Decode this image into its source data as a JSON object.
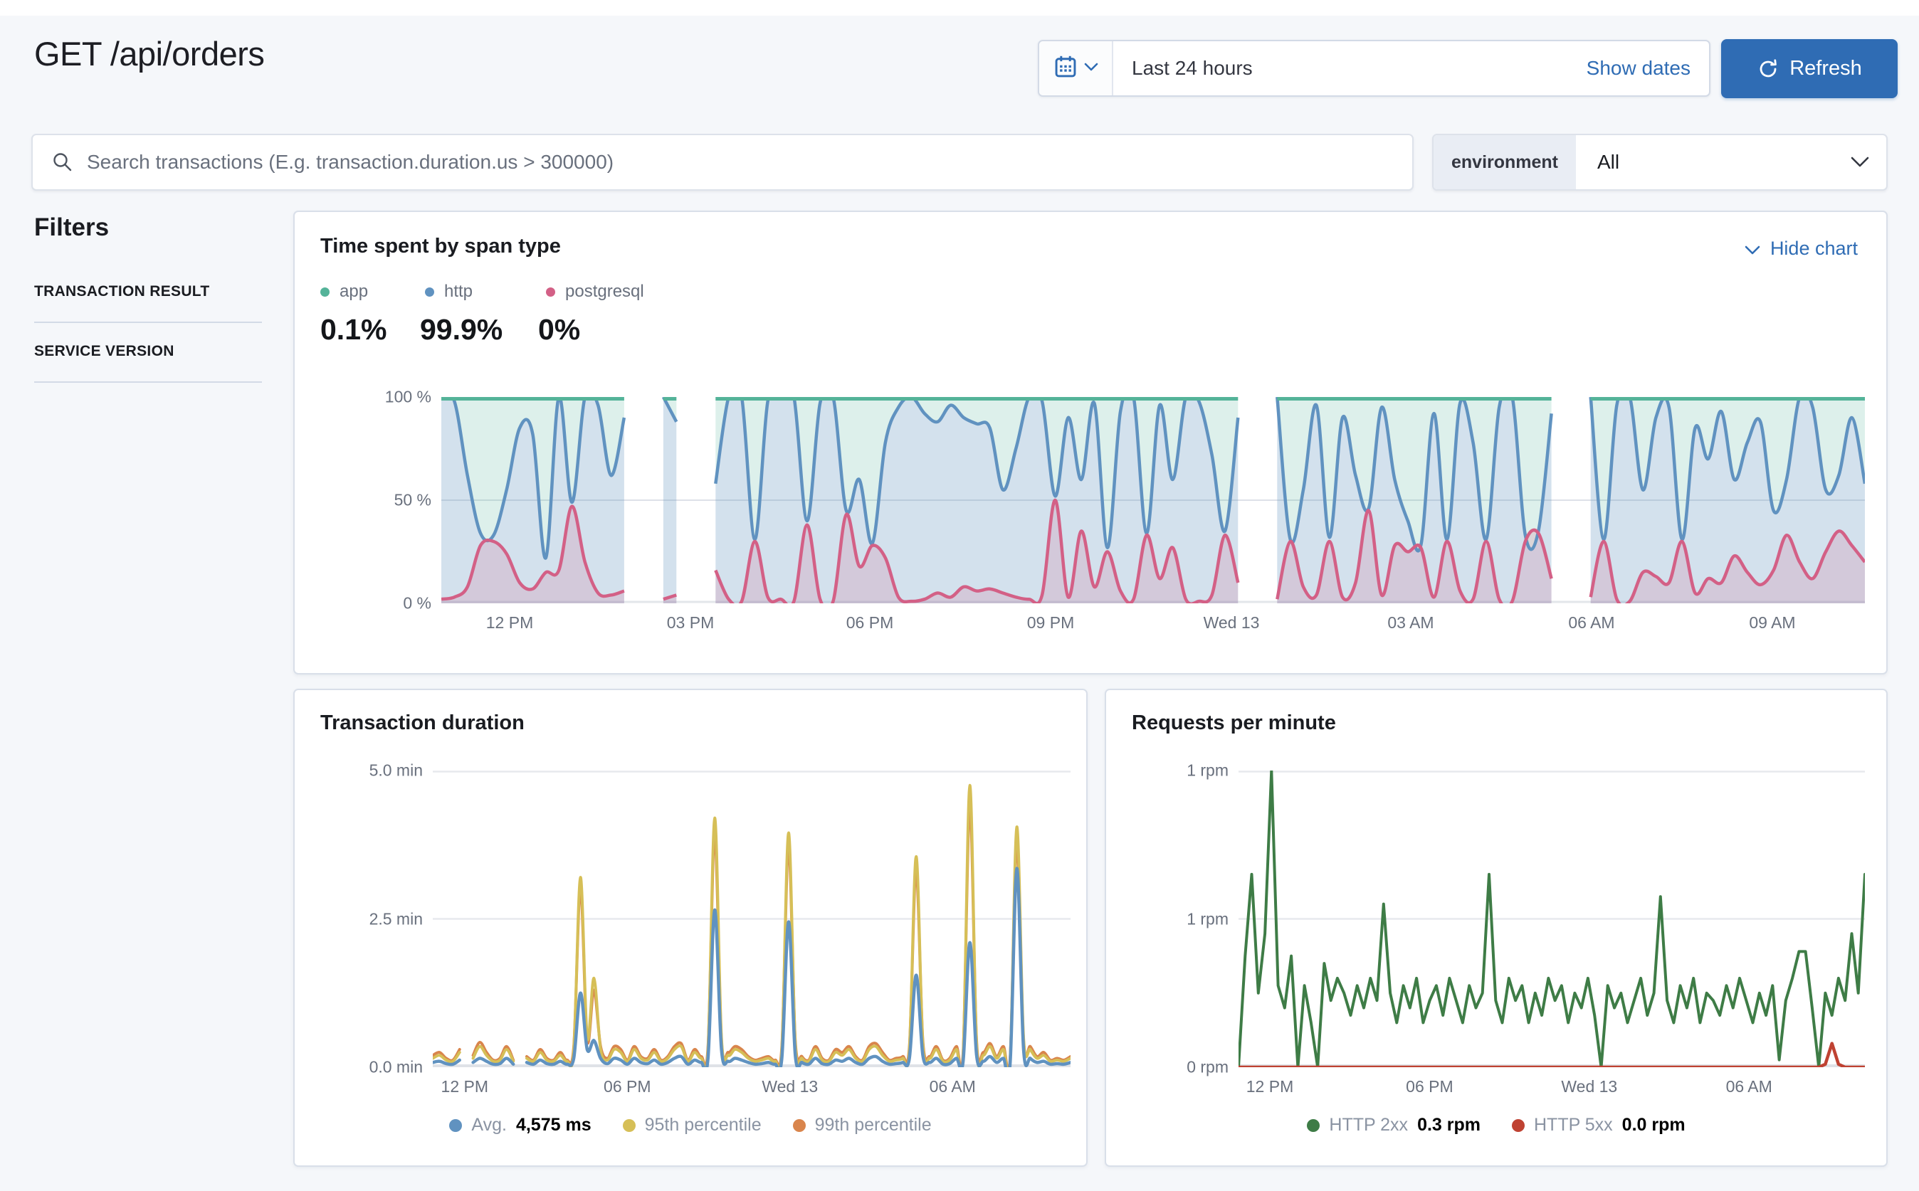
{
  "header": {
    "title": "GET /api/orders",
    "date_picker": {
      "selected_range": "Last 24 hours",
      "show_dates_label": "Show dates"
    },
    "refresh_label": "Refresh"
  },
  "search": {
    "placeholder": "Search transactions (E.g. transaction.duration.us > 300000)",
    "environment_label": "environment",
    "environment_value": "All"
  },
  "filters": {
    "heading": "Filters",
    "sections": [
      {
        "label": "TRANSACTION RESULT"
      },
      {
        "label": "SERVICE VERSION"
      }
    ]
  },
  "colors": {
    "accent_blue": "#2f6cb4",
    "app_green": "#54b399",
    "http_blue": "#6092c0",
    "postgresql_pink": "#d36086",
    "p95_yellow": "#d6bf57",
    "p99_orange": "#d9854c",
    "http2xx_green": "#3e7c46",
    "http5xx_red": "#bf4232"
  },
  "chart_data": [
    {
      "type": "area",
      "title": "Time spent by span type",
      "hide_chart_label": "Hide chart",
      "legend": [
        {
          "label": "app",
          "color": "#54b399",
          "percentage": "0.1%"
        },
        {
          "label": "http",
          "color": "#6092c0",
          "percentage": "99.9%"
        },
        {
          "label": "postgresql",
          "color": "#d36086",
          "percentage": "0%"
        }
      ],
      "ylabel": "",
      "xlabel": "",
      "ylim": [
        0,
        100
      ],
      "y_ticks": [
        "100 %",
        "50 %",
        "0 %"
      ],
      "x_ticks": [
        "12 PM",
        "03 PM",
        "06 PM",
        "09 PM",
        "Wed 13",
        "03 AM",
        "06 AM",
        "09 AM"
      ],
      "x_tick_fracs": [
        0.048,
        0.175,
        0.301,
        0.428,
        0.555,
        0.681,
        0.808,
        0.935
      ],
      "app_fill": "rgba(84,179,153,0.20)",
      "series": [
        {
          "name": "postgresql",
          "color": "#d36086",
          "fill": "rgba(211,96,134,0.18)",
          "values": [
            2,
            3,
            8,
            28,
            30,
            24,
            10,
            7,
            15,
            16,
            47,
            20,
            5,
            4,
            6,
            null,
            null,
            2,
            4,
            null,
            null,
            16,
            2,
            1,
            30,
            3,
            2,
            1,
            38,
            2,
            1,
            43,
            18,
            28,
            22,
            3,
            1,
            2,
            5,
            3,
            8,
            6,
            7,
            5,
            3,
            2,
            4,
            50,
            3,
            35,
            8,
            25,
            6,
            2,
            33,
            12,
            27,
            2,
            1,
            4,
            33,
            10,
            null,
            null,
            2,
            30,
            8,
            4,
            30,
            3,
            10,
            45,
            4,
            28,
            25,
            27,
            3,
            30,
            6,
            2,
            30,
            2,
            1,
            30,
            34,
            12,
            null,
            null,
            3,
            30,
            2,
            1,
            15,
            13,
            10,
            30,
            5,
            12,
            10,
            23,
            15,
            9,
            16,
            33,
            20,
            12,
            25,
            35,
            28,
            20
          ]
        },
        {
          "name": "http",
          "color": "#6092c0",
          "fill": "rgba(96,146,192,0.28)",
          "values": [
            100,
            98,
            62,
            34,
            33,
            55,
            85,
            82,
            22,
            100,
            49,
            100,
            96,
            62,
            90,
            null,
            null,
            100,
            88,
            null,
            null,
            58,
            100,
            100,
            31,
            98,
            100,
            100,
            40,
            97,
            100,
            45,
            60,
            29,
            78,
            95,
            100,
            92,
            88,
            96,
            90,
            87,
            85,
            55,
            75,
            100,
            98,
            52,
            90,
            60,
            97,
            27,
            93,
            100,
            34,
            96,
            60,
            100,
            98,
            72,
            35,
            90,
            null,
            null,
            100,
            31,
            55,
            96,
            32,
            90,
            62,
            46,
            95,
            60,
            40,
            28,
            92,
            31,
            97,
            78,
            31,
            95,
            100,
            33,
            35,
            92,
            null,
            null,
            100,
            31,
            96,
            100,
            55,
            90,
            95,
            31,
            85,
            70,
            93,
            60,
            78,
            88,
            45,
            60,
            100,
            95,
            55,
            62,
            90,
            58
          ]
        }
      ]
    },
    {
      "type": "line",
      "title": "Transaction duration",
      "ylim": [
        0,
        5
      ],
      "y_ticks": [
        "5.0 min",
        "2.5 min",
        "0.0 min"
      ],
      "x_ticks": [
        "12 PM",
        "06 PM",
        "Wed 13",
        "06 AM"
      ],
      "x_tick_fracs": [
        0.05,
        0.305,
        0.56,
        0.815
      ],
      "legend": [
        {
          "label": "Avg.",
          "value": "4,575 ms",
          "color": "#6092c0"
        },
        {
          "label": "95th percentile",
          "value": "",
          "color": "#d6bf57"
        },
        {
          "label": "99th percentile",
          "value": "",
          "color": "#d9854c"
        }
      ],
      "series": [
        {
          "name": "99th percentile",
          "color": "#d9854c",
          "values": [
            0.2,
            0.25,
            0.15,
            0.12,
            0.3,
            null,
            0.2,
            0.42,
            0.25,
            0.12,
            0.15,
            0.35,
            0.12,
            null,
            0.18,
            0.12,
            0.3,
            0.15,
            0.12,
            0.25,
            0.12,
            0.35,
            3.0,
            0.45,
            1.3,
            0.35,
            0.15,
            0.35,
            0.3,
            0.12,
            0.35,
            0.18,
            0.15,
            0.3,
            0.12,
            0.18,
            0.35,
            0.4,
            0.12,
            0.3,
            0.18,
            0.35,
            3.9,
            0.45,
            0.25,
            0.35,
            0.3,
            0.18,
            0.12,
            0.15,
            0.18,
            0.12,
            0.35,
            3.7,
            0.45,
            0.18,
            0.12,
            0.35,
            0.15,
            0.12,
            0.3,
            0.25,
            0.35,
            0.18,
            0.12,
            0.35,
            0.4,
            0.25,
            0.12,
            0.15,
            0.18,
            0.35,
            3.3,
            0.45,
            0.18,
            0.35,
            0.12,
            0.15,
            0.35,
            0.25,
            4.4,
            0.45,
            0.25,
            0.4,
            0.18,
            0.35,
            0.15,
            3.8,
            0.45,
            0.35,
            0.18,
            0.25,
            0.12,
            0.15,
            0.12,
            0.18
          ]
        },
        {
          "name": "95th percentile",
          "color": "#d6bf57",
          "values": [
            0.15,
            0.2,
            0.12,
            0.1,
            0.25,
            null,
            0.15,
            0.35,
            0.2,
            0.1,
            0.12,
            0.3,
            0.1,
            null,
            0.15,
            0.1,
            0.25,
            0.12,
            0.1,
            0.2,
            0.1,
            0.3,
            3.2,
            0.5,
            1.5,
            0.3,
            0.12,
            0.3,
            0.25,
            0.1,
            0.3,
            0.15,
            0.12,
            0.25,
            0.1,
            0.15,
            0.3,
            0.35,
            0.1,
            0.25,
            0.15,
            0.3,
            4.2,
            0.5,
            0.2,
            0.3,
            0.25,
            0.15,
            0.1,
            0.12,
            0.15,
            0.1,
            0.3,
            3.95,
            0.4,
            0.15,
            0.1,
            0.3,
            0.12,
            0.1,
            0.25,
            0.2,
            0.3,
            0.15,
            0.1,
            0.3,
            0.35,
            0.2,
            0.1,
            0.12,
            0.15,
            0.3,
            3.55,
            0.4,
            0.15,
            0.3,
            0.1,
            0.12,
            0.3,
            0.2,
            4.75,
            0.4,
            0.2,
            0.35,
            0.15,
            0.3,
            0.12,
            4.05,
            0.5,
            0.3,
            0.15,
            0.2,
            0.1,
            0.12,
            0.1,
            0.15
          ]
        },
        {
          "name": "Avg.",
          "color": "#6092c0",
          "value_label": "4,575 ms",
          "values": [
            0.08,
            0.1,
            0.06,
            0.05,
            0.12,
            null,
            0.08,
            0.15,
            0.1,
            0.05,
            0.06,
            0.15,
            0.05,
            null,
            0.08,
            0.05,
            0.12,
            0.06,
            0.05,
            0.1,
            0.05,
            0.15,
            1.25,
            0.3,
            0.45,
            0.15,
            0.06,
            0.15,
            0.12,
            0.05,
            0.15,
            0.08,
            0.06,
            0.12,
            0.05,
            0.08,
            0.15,
            0.18,
            0.05,
            0.12,
            0.08,
            0.15,
            2.65,
            0.3,
            0.1,
            0.15,
            0.12,
            0.08,
            0.05,
            0.06,
            0.08,
            0.05,
            0.15,
            2.45,
            0.2,
            0.08,
            0.05,
            0.15,
            0.06,
            0.05,
            0.12,
            0.1,
            0.15,
            0.08,
            0.05,
            0.15,
            0.18,
            0.1,
            0.05,
            0.06,
            0.08,
            0.15,
            1.55,
            0.2,
            0.08,
            0.15,
            0.05,
            0.06,
            0.15,
            0.1,
            2.1,
            0.2,
            0.1,
            0.18,
            0.08,
            0.15,
            0.06,
            3.35,
            0.3,
            0.15,
            0.08,
            0.1,
            0.05,
            0.06,
            0.05,
            0.08
          ]
        }
      ]
    },
    {
      "type": "line",
      "title": "Requests per minute",
      "ylim": [
        0,
        2
      ],
      "y_ticks": [
        "1 rpm",
        "1 rpm",
        "0 rpm"
      ],
      "x_ticks": [
        "12 PM",
        "06 PM",
        "Wed 13",
        "06 AM"
      ],
      "x_tick_fracs": [
        0.05,
        0.305,
        0.56,
        0.815
      ],
      "legend": [
        {
          "label": "HTTP 2xx",
          "value": "0.3 rpm",
          "color": "#3e7c46"
        },
        {
          "label": "HTTP 5xx",
          "value": "0.0 rpm",
          "color": "#bf4232"
        }
      ],
      "series": [
        {
          "name": "HTTP 2xx",
          "color": "#3e7c46",
          "values": [
            0,
            0.75,
            1.3,
            0.5,
            0.9,
            2.0,
            0.55,
            0.4,
            0.75,
            0,
            0.55,
            0.3,
            0,
            0.7,
            0.45,
            0.6,
            0.5,
            0.35,
            0.55,
            0.4,
            0.6,
            0.45,
            1.1,
            0.5,
            0.3,
            0.55,
            0.4,
            0.6,
            0.3,
            0.45,
            0.55,
            0.35,
            0.6,
            0.45,
            0.3,
            0.55,
            0.4,
            0.5,
            1.3,
            0.45,
            0.3,
            0.6,
            0.45,
            0.55,
            0.3,
            0.5,
            0.35,
            0.6,
            0.45,
            0.55,
            0.3,
            0.5,
            0.4,
            0.6,
            0.35,
            0,
            0.55,
            0.4,
            0.5,
            0.3,
            0.45,
            0.6,
            0.35,
            0.5,
            1.15,
            0.45,
            0.3,
            0.55,
            0.4,
            0.6,
            0.3,
            0.5,
            0.45,
            0.35,
            0.55,
            0.4,
            0.6,
            0.45,
            0.3,
            0.5,
            0.35,
            0.55,
            0.05,
            0.45,
            0.6,
            0.78,
            0.78,
            0.4,
            0,
            0.5,
            0.35,
            0.6,
            0.45,
            0.9,
            0.5,
            1.3
          ]
        },
        {
          "name": "HTTP 5xx",
          "color": "#bf4232",
          "values": [
            0,
            0,
            0,
            0,
            0,
            0,
            0,
            0,
            0,
            0,
            0,
            0,
            0,
            0,
            0,
            0,
            0,
            0,
            0,
            0,
            0,
            0,
            0,
            0,
            0,
            0,
            0,
            0,
            0,
            0,
            0,
            0,
            0,
            0,
            0,
            0,
            0,
            0,
            0,
            0,
            0,
            0,
            0,
            0,
            0,
            0,
            0,
            0,
            0,
            0,
            0,
            0,
            0,
            0,
            0,
            0,
            0,
            0,
            0,
            0,
            0,
            0,
            0,
            0,
            0,
            0,
            0,
            0,
            0,
            0,
            0,
            0,
            0,
            0,
            0,
            0,
            0,
            0,
            0,
            0,
            0,
            0,
            0,
            0,
            0,
            0,
            0,
            0,
            0,
            0.02,
            0.16,
            0.02,
            0,
            0,
            0,
            0
          ]
        }
      ]
    }
  ]
}
